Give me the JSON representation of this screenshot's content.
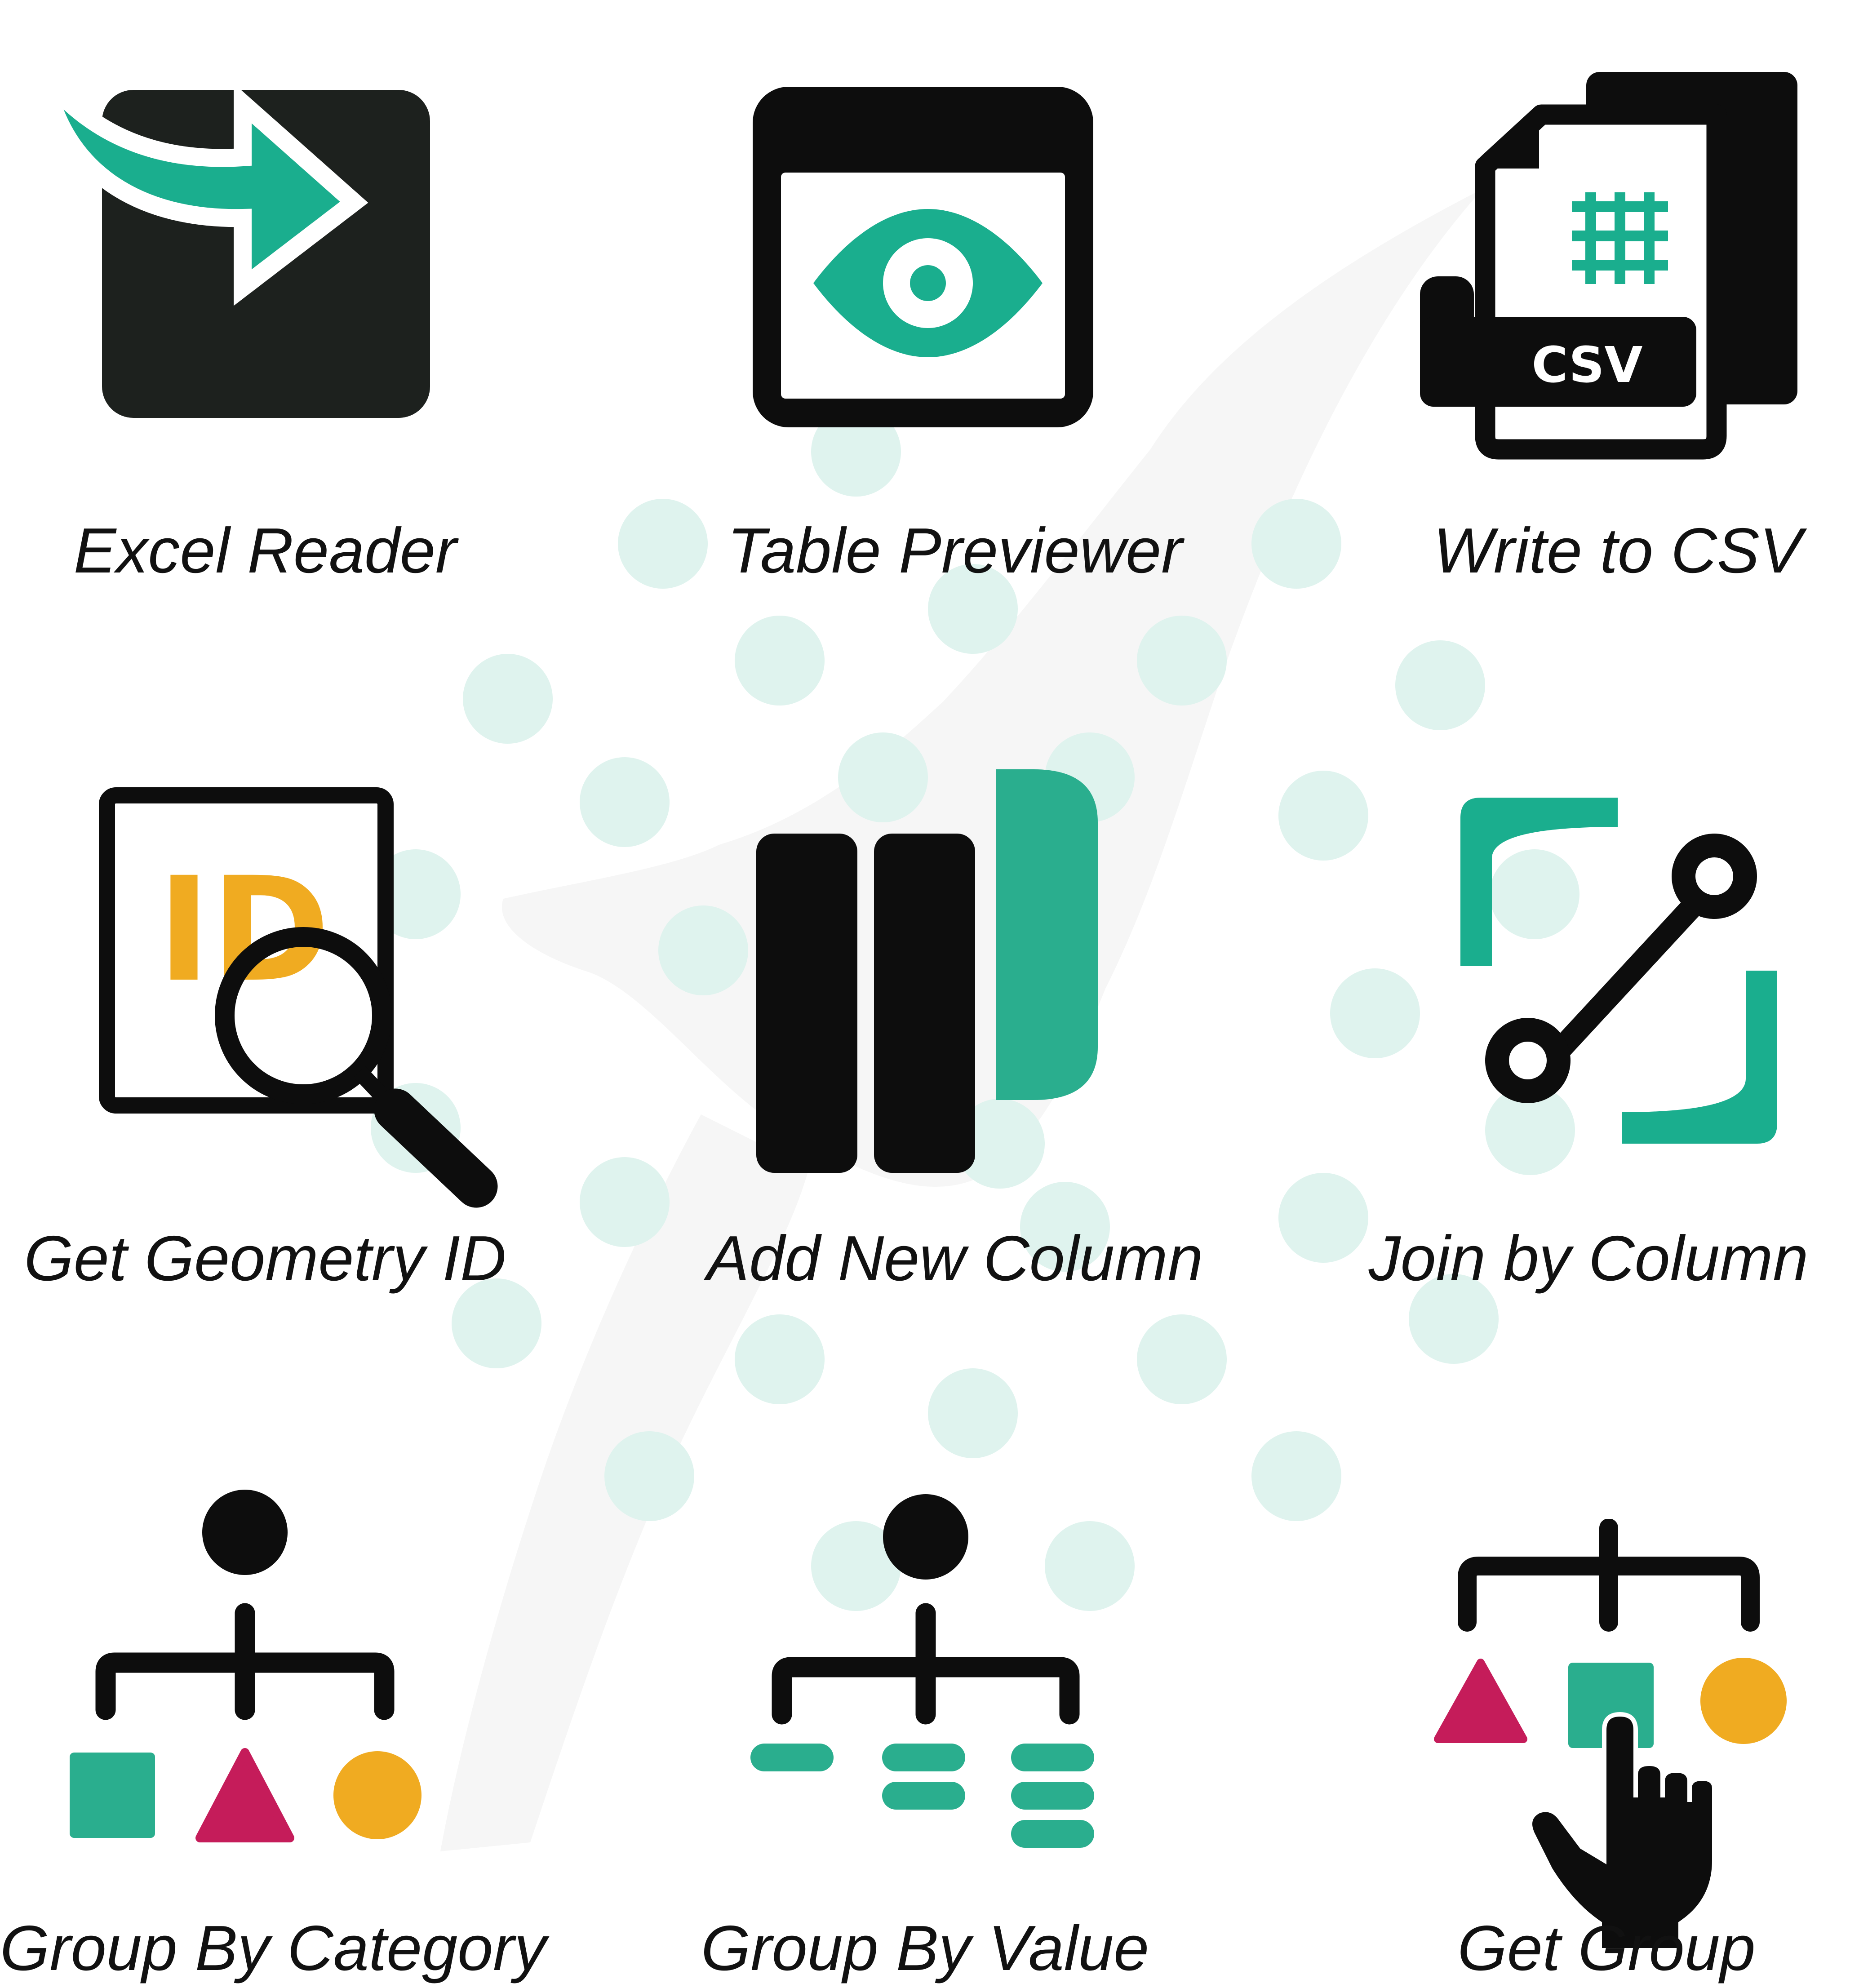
{
  "colors": {
    "teal": "#1aae8e",
    "black": "#0d0d0d",
    "dark": "#1d211e",
    "orange": "#f0ab21",
    "magenta": "#c51c5a",
    "watermark_dot": "#dff3ee",
    "watermark_shape": "#f6f6f6"
  },
  "nodes": [
    {
      "label": "Excel Reader",
      "icon": "excel-reader-icon"
    },
    {
      "label": "Table Previewer",
      "icon": "table-previewer-icon"
    },
    {
      "label": "Write to CSV",
      "icon": "write-to-csv-icon",
      "badge": "CSV"
    },
    {
      "label": "Get Geometry ID",
      "icon": "get-geometry-id-icon",
      "badge": "ID"
    },
    {
      "label": "Add New Column",
      "icon": "add-new-column-icon"
    },
    {
      "label": "Join by Column",
      "icon": "join-by-column-icon"
    },
    {
      "label": "Group By Category",
      "icon": "group-by-category-icon"
    },
    {
      "label": "Group By Value",
      "icon": "group-by-value-icon"
    },
    {
      "label": "Get Group",
      "icon": "get-group-icon"
    }
  ]
}
